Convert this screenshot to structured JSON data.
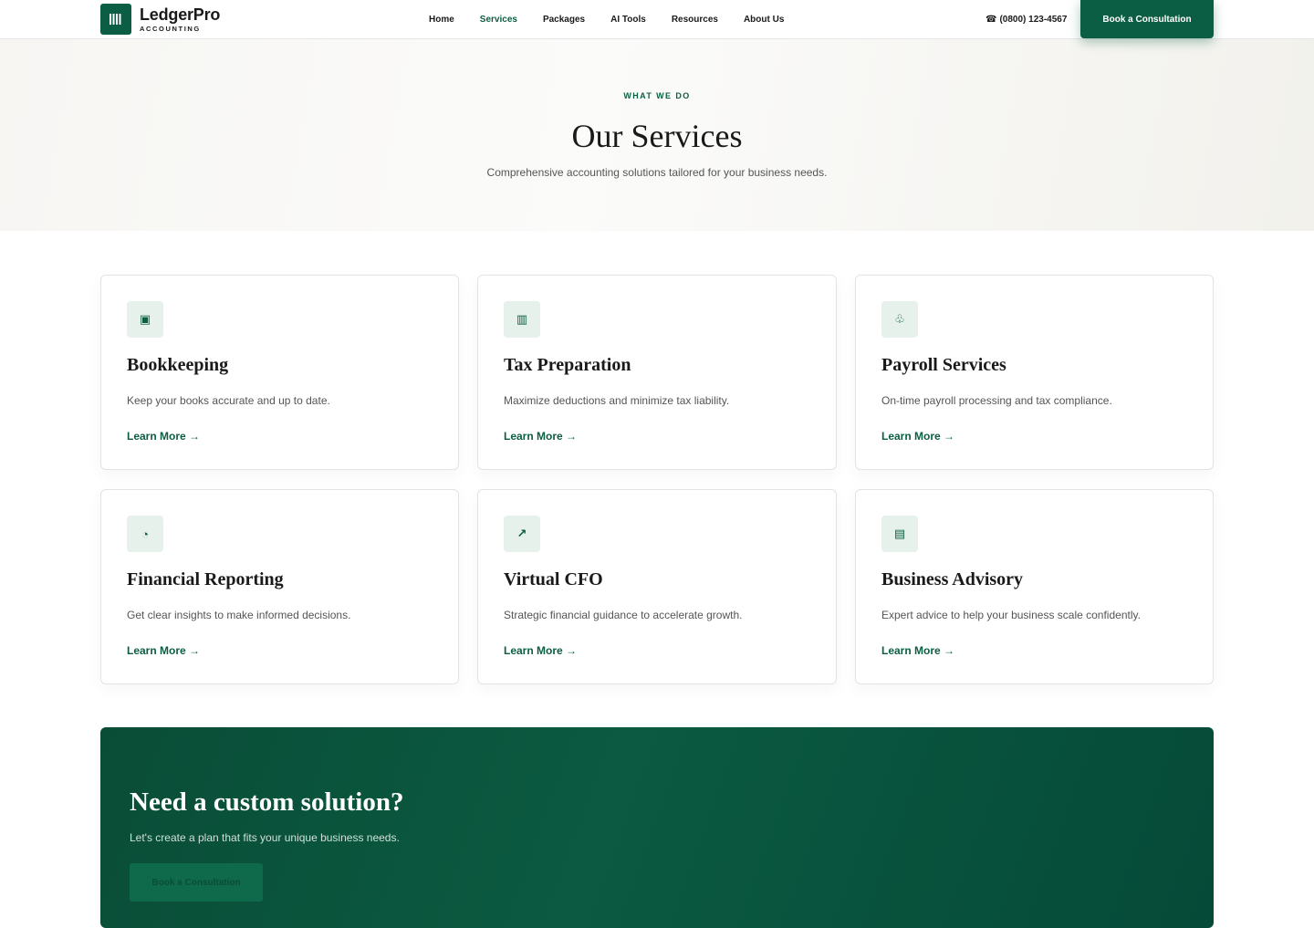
{
  "header": {
    "logo_name": "LedgerPro",
    "logo_sub": "ACCOUNTING",
    "nav": [
      {
        "label": "Home",
        "active": false
      },
      {
        "label": "Services",
        "active": true
      },
      {
        "label": "Packages",
        "active": false
      },
      {
        "label": "AI Tools",
        "active": false
      },
      {
        "label": "Resources",
        "active": false
      },
      {
        "label": "About Us",
        "active": false
      }
    ],
    "phone_icon": "☎",
    "phone": "(0800) 123-4567",
    "cta_label": "Book a Consultation"
  },
  "hero": {
    "eyebrow": "WHAT WE DO",
    "title": "Our Services",
    "subtitle": "Comprehensive accounting solutions tailored for your business needs."
  },
  "services": [
    {
      "icon": "ledger-book-icon",
      "glyph": "▣",
      "title": "Bookkeeping",
      "description": "Keep your books accurate and up to date.",
      "link": "Learn More →"
    },
    {
      "icon": "tax-document-icon",
      "glyph": "▥",
      "title": "Tax Preparation",
      "description": "Maximize deductions and minimize tax liability.",
      "link": "Learn More →"
    },
    {
      "icon": "payroll-icon",
      "glyph": "♧",
      "title": "Payroll Services",
      "description": "On-time payroll processing and tax compliance.",
      "link": "Learn More →"
    },
    {
      "icon": "pie-chart-icon",
      "glyph": "◔",
      "title": "Financial Reporting",
      "description": "Get clear insights to make informed decisions.",
      "link": "Learn More →"
    },
    {
      "icon": "trend-arrow-icon",
      "glyph": "↗",
      "title": "Virtual CFO",
      "description": "Strategic financial guidance to accelerate growth.",
      "link": "Learn More →"
    },
    {
      "icon": "report-list-icon",
      "glyph": "▤",
      "title": "Business Advisory",
      "description": "Expert advice to help your business scale confidently.",
      "link": "Learn More →"
    }
  ],
  "cta_band": {
    "title": "Need a custom solution?",
    "subtitle": "Let's create a plan that fits your unique business needs.",
    "button_label": "Book a Consultation"
  },
  "colors": {
    "brand": "#0b5e43",
    "icon_bg": "#e6f1ec"
  }
}
